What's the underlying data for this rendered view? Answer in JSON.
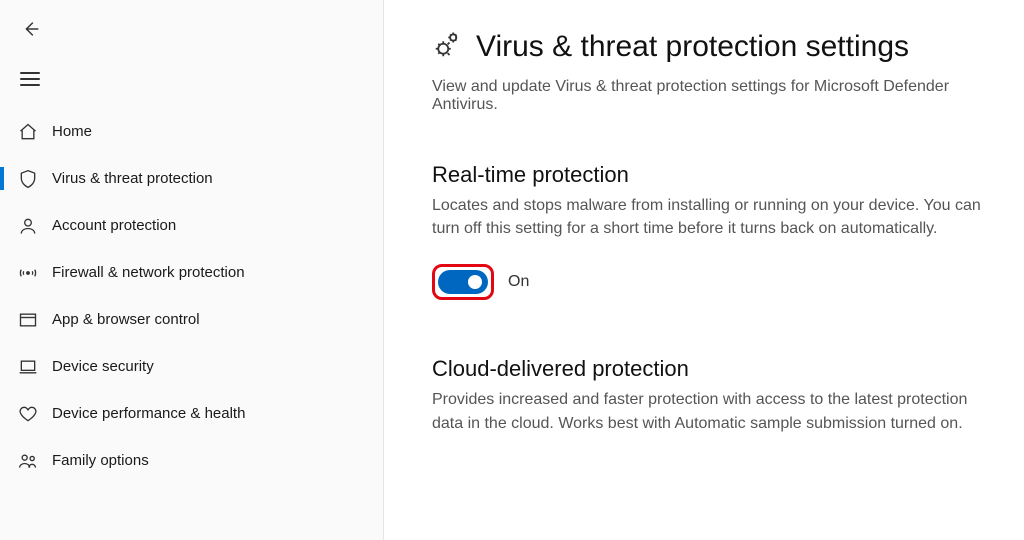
{
  "sidebar": {
    "items": [
      {
        "label": "Home"
      },
      {
        "label": "Virus & threat protection"
      },
      {
        "label": "Account protection"
      },
      {
        "label": "Firewall & network protection"
      },
      {
        "label": "App & browser control"
      },
      {
        "label": "Device security"
      },
      {
        "label": "Device performance & health"
      },
      {
        "label": "Family options"
      }
    ]
  },
  "page": {
    "title": "Virus & threat protection settings",
    "subtitle": "View and update Virus & threat protection settings for Microsoft Defender Antivirus."
  },
  "realtime": {
    "heading": "Real-time protection",
    "desc": "Locates and stops malware from installing or running on your device. You can turn off this setting for a short time before it turns back on automatically.",
    "state_label": "On",
    "state": true
  },
  "cloud": {
    "heading": "Cloud-delivered protection",
    "desc": "Provides increased and faster protection with access to the latest protection data in the cloud. Works best with Automatic sample submission turned on."
  }
}
